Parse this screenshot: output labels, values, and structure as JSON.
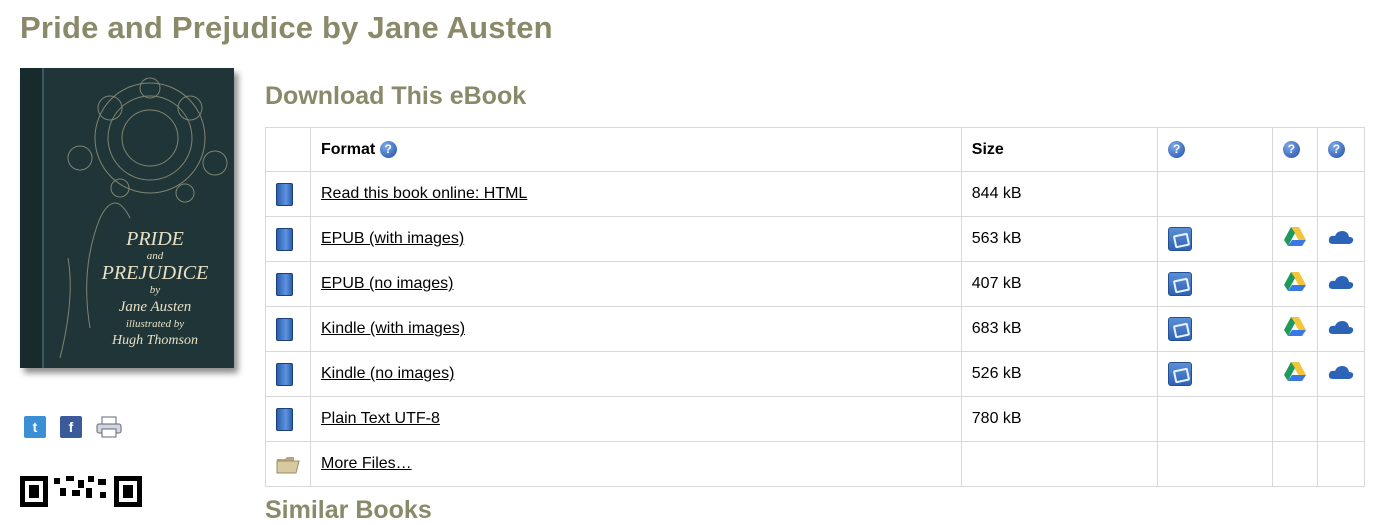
{
  "page": {
    "title": "Pride and Prejudice by Jane Austen"
  },
  "cover": {
    "line1": "PRIDE",
    "line2": "and",
    "line3": "PREJUDICE",
    "line4": "by",
    "line5": "Jane Austen",
    "line6": "illustrated by",
    "line7": "Hugh Thomson"
  },
  "download": {
    "heading": "Download This eBook",
    "columns": {
      "format": "Format",
      "size": "Size",
      "help_glyph": "?"
    },
    "rows": [
      {
        "label": "Read this book online: HTML",
        "size": "844 kB",
        "icon": "book-icon",
        "dropbox": false,
        "gdrive": false,
        "onedrive": false
      },
      {
        "label": "EPUB (with images)",
        "size": "563 kB",
        "icon": "book-icon",
        "dropbox": true,
        "gdrive": true,
        "onedrive": true
      },
      {
        "label": "EPUB (no images)",
        "size": "407 kB",
        "icon": "book-icon",
        "dropbox": true,
        "gdrive": true,
        "onedrive": true
      },
      {
        "label": "Kindle (with images)",
        "size": "683 kB",
        "icon": "book-icon",
        "dropbox": true,
        "gdrive": true,
        "onedrive": true
      },
      {
        "label": "Kindle (no images)",
        "size": "526 kB",
        "icon": "book-icon",
        "dropbox": true,
        "gdrive": true,
        "onedrive": true
      },
      {
        "label": "Plain Text UTF-8",
        "size": "780 kB",
        "icon": "book-icon",
        "dropbox": false,
        "gdrive": false,
        "onedrive": false
      },
      {
        "label": "More Files…",
        "size": "",
        "icon": "folder-icon",
        "dropbox": false,
        "gdrive": false,
        "onedrive": false
      }
    ]
  },
  "social": {
    "twitter": "t",
    "facebook": "f"
  },
  "colors": {
    "heading": "#8a8a6a",
    "link": "#000000",
    "border": "#d8d8d8"
  },
  "similar": {
    "heading": "Similar Books"
  }
}
